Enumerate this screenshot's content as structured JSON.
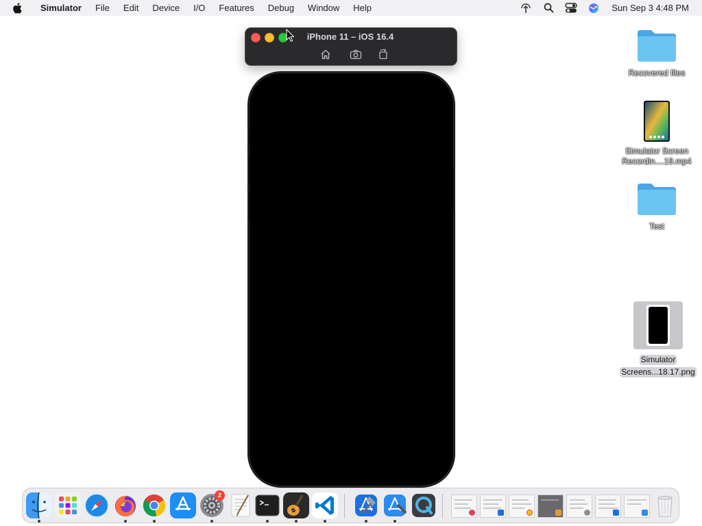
{
  "menubar": {
    "app_name": "Simulator",
    "items": [
      "File",
      "Edit",
      "Device",
      "I/O",
      "Features",
      "Debug",
      "Window",
      "Help"
    ],
    "clock": "Sun Sep 3  4:48 PM",
    "status_icons": [
      "airdrop-icon",
      "search-icon",
      "control-center-icon",
      "siri-icon"
    ]
  },
  "simulator": {
    "title": "iPhone 11 – iOS 16.4",
    "toolbar_icons": [
      "home-icon",
      "screenshot-icon",
      "rotate-icon"
    ]
  },
  "desktop": {
    "icons": [
      {
        "name": "folder-icon",
        "label": "Recovered files"
      },
      {
        "name": "video-thumbnail-icon",
        "label_line1": "Simulator Screen",
        "label_line2": "Recordin....19.mp4"
      },
      {
        "name": "folder-icon",
        "label": "Test"
      },
      {
        "name": "png-thumbnail-icon",
        "label_line1": "Simulator",
        "label_line2": "Screens...18.17.png",
        "selected": true
      }
    ]
  },
  "dock": {
    "apps": [
      "Finder",
      "Launchpad",
      "Safari",
      "Firefox",
      "Chrome",
      "App Store",
      "System Settings",
      "TextEdit",
      "Terminal",
      "GarageBand",
      "Visual Studio Code",
      "Xcode",
      "Simulator",
      "QuickTime Player"
    ],
    "system_settings_badge": "2",
    "trash": "Trash"
  },
  "colors": {
    "menubar_bg": "#f1f1f4",
    "window_toolbar_bg": "#2a2a2c",
    "folder_blue": "#5ab5ec",
    "close_red": "#fe5f57",
    "minimize_yellow": "#febc2e",
    "zoom_green": "#28c840"
  }
}
